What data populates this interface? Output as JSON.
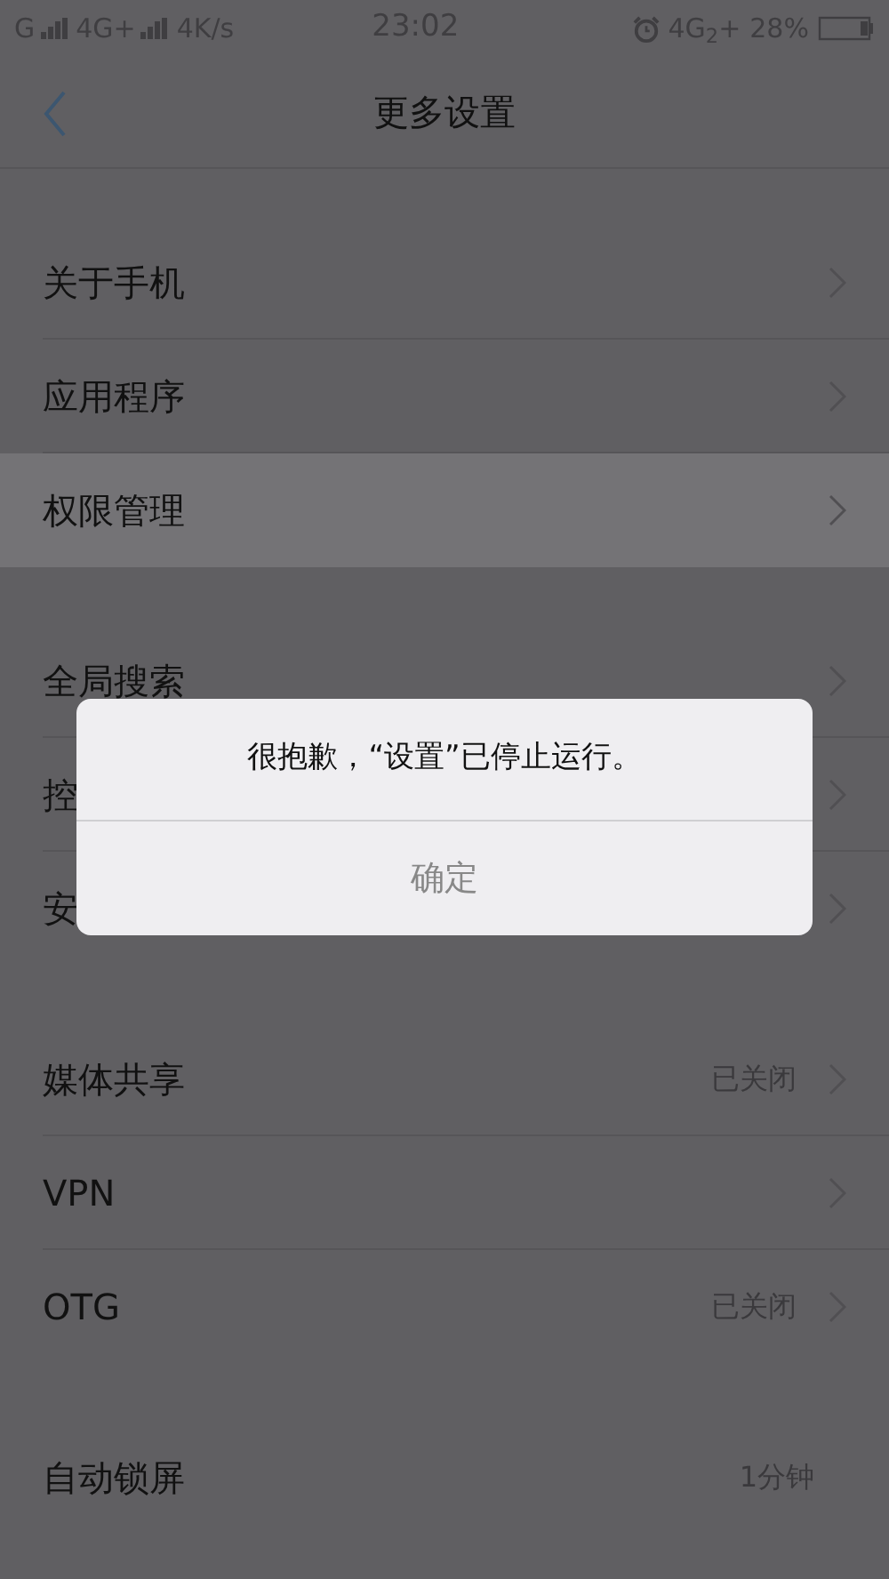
{
  "status_bar": {
    "left": [
      "G",
      "4G+",
      "4K/s"
    ],
    "time": "23:02",
    "network": "4G$_{2}$+",
    "battery": "28%"
  },
  "header": {
    "title": "更多设置"
  },
  "groups": [
    {
      "items": [
        {
          "label": "关于手机",
          "chevron": true,
          "highlighted": false
        },
        {
          "label": "应用程序",
          "chevron": true,
          "highlighted": false
        },
        {
          "label": "权限管理",
          "chevron": true,
          "highlighted": true
        }
      ]
    },
    {
      "items": [
        {
          "label": "全局搜索",
          "chevron": true,
          "highlighted": false
        },
        {
          "label": "控",
          "chevron": true,
          "highlighted": false
        },
        {
          "label": "安",
          "chevron": true,
          "highlighted": false
        }
      ]
    },
    {
      "items": [
        {
          "label": "媒体共享",
          "value": "已关闭",
          "chevron": true,
          "highlighted": false
        },
        {
          "label": "VPN",
          "chevron": true,
          "highlighted": false
        },
        {
          "label": "OTG",
          "value": "已关闭",
          "chevron": true,
          "highlighted": false
        }
      ]
    },
    {
      "items": [
        {
          "label": "自动锁屏",
          "value": "1分钟",
          "chevron": false,
          "highlighted": false
        }
      ]
    }
  ],
  "dialog": {
    "message": "很抱歉，“设置”已停止运行。",
    "button": "确定"
  }
}
